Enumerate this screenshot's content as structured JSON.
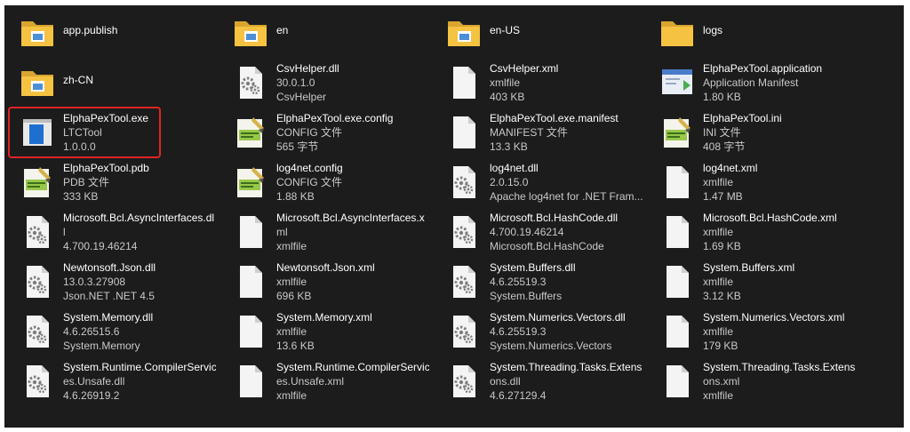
{
  "items": [
    {
      "icon": "folder-picture-icon",
      "lines": [
        "app.publish"
      ]
    },
    {
      "icon": "folder-picture-icon",
      "lines": [
        "en"
      ]
    },
    {
      "icon": "folder-picture-icon",
      "lines": [
        "en-US"
      ]
    },
    {
      "icon": "folder-icon",
      "lines": [
        "logs"
      ]
    },
    {
      "icon": "folder-picture-icon",
      "lines": [
        "zh-CN"
      ]
    },
    {
      "icon": "dll-gear-icon",
      "lines": [
        "CsvHelper.dll",
        "30.0.1.0",
        "CsvHelper"
      ]
    },
    {
      "icon": "blank-file-icon",
      "lines": [
        "CsvHelper.xml",
        "xmlfile",
        "403 KB"
      ]
    },
    {
      "icon": "application-manifest-icon",
      "lines": [
        "ElphaPexTool.application",
        "Application Manifest",
        "1.80 KB"
      ]
    },
    {
      "icon": "exe-app-icon",
      "lines": [
        "ElphaPexTool.exe",
        "LTCTool",
        "1.0.0.0"
      ],
      "selected": true
    },
    {
      "icon": "notepad-plus-plus-icon",
      "lines": [
        "ElphaPexTool.exe.config",
        "CONFIG 文件",
        "565 字节"
      ]
    },
    {
      "icon": "blank-file-icon",
      "lines": [
        "ElphaPexTool.exe.manifest",
        "MANIFEST 文件",
        "13.3 KB"
      ]
    },
    {
      "icon": "notepad-plus-plus-icon",
      "lines": [
        "ElphaPexTool.ini",
        "INI 文件",
        "408 字节"
      ]
    },
    {
      "icon": "notepad-plus-plus-icon",
      "lines": [
        "ElphaPexTool.pdb",
        "PDB 文件",
        "333 KB"
      ]
    },
    {
      "icon": "notepad-plus-plus-icon",
      "lines": [
        "log4net.config",
        "CONFIG 文件",
        "1.88 KB"
      ]
    },
    {
      "icon": "dll-gear-icon",
      "lines": [
        "log4net.dll",
        "2.0.15.0",
        "Apache log4net for .NET Fram..."
      ]
    },
    {
      "icon": "blank-file-icon",
      "lines": [
        "log4net.xml",
        "xmlfile",
        "1.47 MB"
      ]
    },
    {
      "icon": "dll-gear-icon",
      "lines": [
        "Microsoft.Bcl.AsyncInterfaces.dl",
        "l",
        "4.700.19.46214"
      ]
    },
    {
      "icon": "blank-file-icon",
      "lines": [
        "Microsoft.Bcl.AsyncInterfaces.x",
        "ml",
        "xmlfile"
      ]
    },
    {
      "icon": "dll-gear-icon",
      "lines": [
        "Microsoft.Bcl.HashCode.dll",
        "4.700.19.46214",
        "Microsoft.Bcl.HashCode"
      ]
    },
    {
      "icon": "blank-file-icon",
      "lines": [
        "Microsoft.Bcl.HashCode.xml",
        "xmlfile",
        "1.69 KB"
      ]
    },
    {
      "icon": "dll-gear-icon",
      "lines": [
        "Newtonsoft.Json.dll",
        "13.0.3.27908",
        "Json.NET .NET 4.5"
      ]
    },
    {
      "icon": "blank-file-icon",
      "lines": [
        "Newtonsoft.Json.xml",
        "xmlfile",
        "696 KB"
      ]
    },
    {
      "icon": "dll-gear-icon",
      "lines": [
        "System.Buffers.dll",
        "4.6.25519.3",
        "System.Buffers"
      ]
    },
    {
      "icon": "blank-file-icon",
      "lines": [
        "System.Buffers.xml",
        "xmlfile",
        "3.12 KB"
      ]
    },
    {
      "icon": "dll-gear-icon",
      "lines": [
        "System.Memory.dll",
        "4.6.26515.6",
        "System.Memory"
      ]
    },
    {
      "icon": "blank-file-icon",
      "lines": [
        "System.Memory.xml",
        "xmlfile",
        "13.6 KB"
      ]
    },
    {
      "icon": "dll-gear-icon",
      "lines": [
        "System.Numerics.Vectors.dll",
        "4.6.25519.3",
        "System.Numerics.Vectors"
      ]
    },
    {
      "icon": "blank-file-icon",
      "lines": [
        "System.Numerics.Vectors.xml",
        "xmlfile",
        "179 KB"
      ]
    },
    {
      "icon": "dll-gear-icon",
      "lines": [
        "System.Runtime.CompilerServic",
        "es.Unsafe.dll",
        "4.6.26919.2"
      ]
    },
    {
      "icon": "blank-file-icon",
      "lines": [
        "System.Runtime.CompilerServic",
        "es.Unsafe.xml",
        "xmlfile"
      ]
    },
    {
      "icon": "dll-gear-icon",
      "lines": [
        "System.Threading.Tasks.Extensi",
        "ons.dll",
        "4.6.27129.4"
      ]
    },
    {
      "icon": "blank-file-icon",
      "lines": [
        "System.Threading.Tasks.Extensi",
        "ons.xml",
        "xmlfile"
      ]
    }
  ],
  "colors": {
    "background": "#1c1c1c",
    "name_text": "#ffffff",
    "detail_text": "#c8c8c8",
    "selection_border": "#e02424",
    "folder": "#f5c242"
  }
}
